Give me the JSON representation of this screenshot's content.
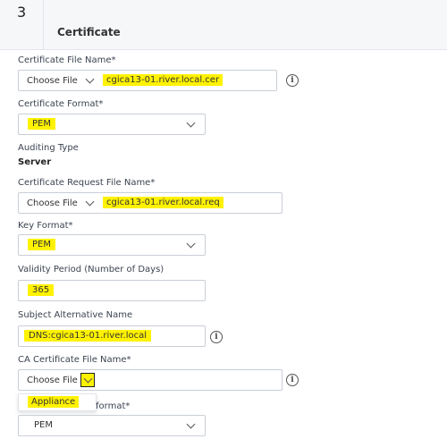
{
  "step": {
    "number": "3",
    "title": "Certificate"
  },
  "certificate_file": {
    "label": "Certificate File Name*",
    "button": "Choose File",
    "filename": "cgica13-01.river.local.cer"
  },
  "certificate_format": {
    "label": "Certificate Format*",
    "value": "PEM"
  },
  "auditing": {
    "label": "Auditing Type",
    "value": "Server"
  },
  "request_file": {
    "label": "Certificate Request File Name*",
    "button": "Choose File",
    "filename": "cgica13-01.river.local.req"
  },
  "key_format": {
    "label": "Key Format*",
    "value": "PEM"
  },
  "validity": {
    "label": "Validity Period (Number of Days)",
    "value": "365"
  },
  "san": {
    "label": "Subject Alternative Name",
    "value": "DNS:cgica13-01.river.local"
  },
  "ca_file": {
    "label": "CA Certificate File Name*",
    "button": "Choose File",
    "filename": ""
  },
  "dropdown": {
    "items": [
      "Appliance"
    ]
  },
  "ca_format": {
    "label_fragment": "format*",
    "value": "PEM"
  },
  "icons": {
    "info": "info-icon",
    "chevron": "chevron-down-icon"
  },
  "colors": {
    "highlight": "#fff200",
    "border": "#c9cfd6",
    "header_bg": "#f5f7f9"
  }
}
